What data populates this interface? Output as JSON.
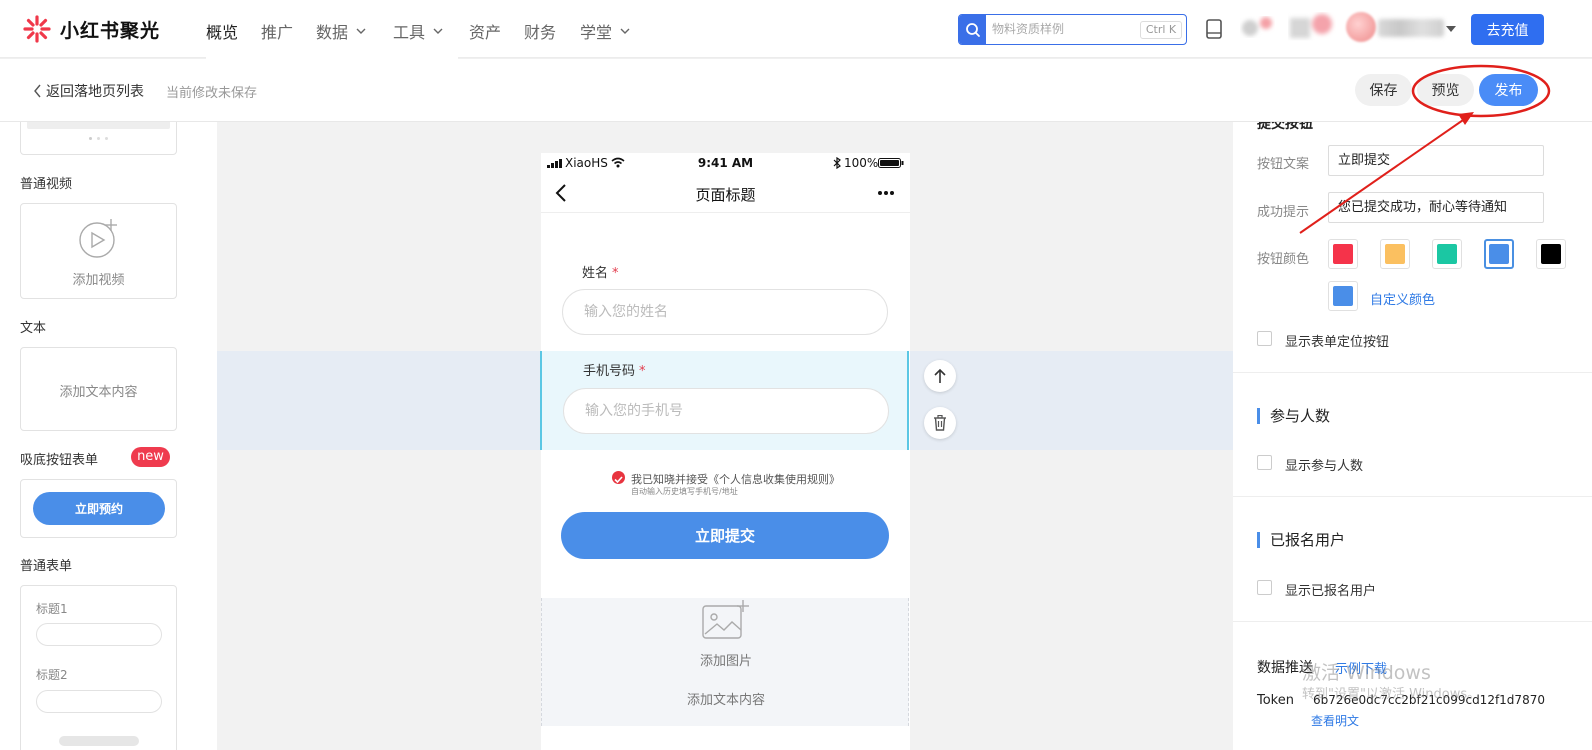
{
  "brand": {
    "name": "小红书聚光"
  },
  "nav": {
    "items": [
      {
        "label": "概览",
        "has_dropdown": false,
        "active": true
      },
      {
        "label": "推广",
        "has_dropdown": false,
        "active": false
      },
      {
        "label": "数据",
        "has_dropdown": true,
        "active": false
      },
      {
        "label": "工具",
        "has_dropdown": true,
        "active": false
      },
      {
        "label": "资产",
        "has_dropdown": false,
        "active": false
      },
      {
        "label": "财务",
        "has_dropdown": false,
        "active": false
      },
      {
        "label": "学堂",
        "has_dropdown": true,
        "active": false
      }
    ]
  },
  "search": {
    "placeholder": "物料资质样例",
    "shortcut": "Ctrl K"
  },
  "header": {
    "recharge_label": "去充值"
  },
  "editor": {
    "back_label": "返回落地页列表",
    "status": "当前修改未保存",
    "save_label": "保存",
    "preview_label": "预览",
    "publish_label": "发布"
  },
  "components": {
    "video": {
      "title": "普通视频",
      "action": "添加视频"
    },
    "text": {
      "title": "文本",
      "action": "添加文本内容"
    },
    "sticky_form": {
      "title": "吸底按钮表单",
      "badge": "new",
      "button": "立即预约"
    },
    "normal_form": {
      "title": "普通表单",
      "field1": "标题1",
      "field2": "标题2"
    }
  },
  "phone": {
    "carrier": "XiaoHS",
    "time": "9:41 AM",
    "battery": "100%",
    "page_title": "页面标题",
    "fields": [
      {
        "label": "姓名",
        "required_mark": "*",
        "placeholder": "输入您的姓名"
      },
      {
        "label": "手机号码",
        "required_mark": "*",
        "placeholder": "输入您的手机号"
      }
    ],
    "agreement": "我已知晓并接受《个人信息收集使用规则》",
    "agreement_sub": "自动输入历史填写手机号/地址",
    "submit_label": "立即提交",
    "image_block_label": "添加图片",
    "text_block_label": "添加文本内容"
  },
  "settings": {
    "cut_heading": "提交按钮",
    "button_text_label": "按钮文案",
    "button_text_value": "立即提交",
    "success_label": "成功提示",
    "success_value": "您已提交成功，耐心等待通知",
    "button_color_label": "按钮颜色",
    "colors": [
      "#f5334a",
      "#fbc060",
      "#1bc7a3",
      "#4a8ee8",
      "#000000"
    ],
    "selected_color": "#4a8ee8",
    "custom_color": "#4a8ee8",
    "custom_color_label": "自定义颜色",
    "show_locate_button": "显示表单定位按钮",
    "participants_title": "参与人数",
    "show_participants": "显示参与人数",
    "registered_title": "已报名用户",
    "show_registered": "显示已报名用户",
    "data_push_title": "数据推送",
    "sample_download": "示例下载",
    "token_label": "Token",
    "token_value": "6b726e0dc7cc2bf21c099cd12f1d7870",
    "view_plain": "查看明文"
  },
  "watermark": {
    "line1": "激活 Windows",
    "line2": "转到\"设置\"以激活 Windows。"
  },
  "theme": {
    "accent": "#2f6ef0",
    "form_blue": "#4a8ee8",
    "annotation_red": "#e0201b"
  }
}
